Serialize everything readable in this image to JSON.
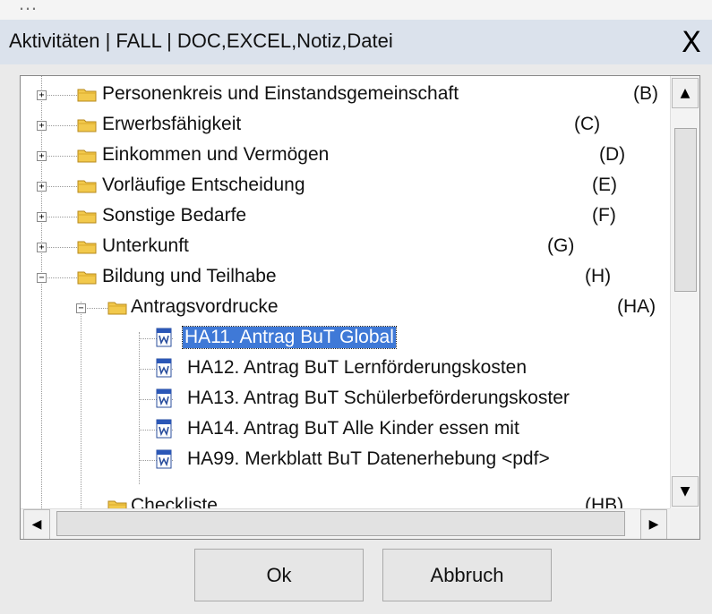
{
  "window": {
    "title": "Aktivitäten | FALL | DOC,EXCEL,Notiz,Datei",
    "close_label": "X",
    "clipped_top_text": "…"
  },
  "tree": {
    "items": [
      {
        "label": "Personenkreis und Einstandsgemeinschaft",
        "code": "(B)",
        "expanded": false
      },
      {
        "label": "Erwerbsfähigkeit",
        "code": "(C)",
        "expanded": false
      },
      {
        "label": "Einkommen und Vermögen",
        "code": "(D)",
        "expanded": false
      },
      {
        "label": "Vorläufige Entscheidung",
        "code": "(E)",
        "expanded": false
      },
      {
        "label": "Sonstige Bedarfe",
        "code": "(F)",
        "expanded": false
      },
      {
        "label": "Unterkunft",
        "code": "(G)",
        "expanded": false
      },
      {
        "label": "Bildung und Teilhabe",
        "code": "(H)",
        "expanded": true
      },
      {
        "label": "Antragsvordrucke",
        "code": "(HA)",
        "expanded": true
      },
      {
        "label": "HA11. Antrag BuT Global",
        "code": "",
        "selected": true
      },
      {
        "label": "HA12. Antrag BuT Lernförderungskosten",
        "code": ""
      },
      {
        "label": "HA13. Antrag BuT Schülerbeförderungskoster",
        "code": ""
      },
      {
        "label": "HA14. Antrag BuT Alle Kinder essen mit",
        "code": ""
      },
      {
        "label": "HA99. Merkblatt BuT Datenerhebung  <pdf>",
        "code": ""
      },
      {
        "label": "Checkliste",
        "code": "(HB)",
        "partially_visible": true
      }
    ]
  },
  "scroll": {
    "up_arrow": "▲",
    "down_arrow": "▼",
    "left_arrow": "◀",
    "right_arrow": "▶"
  },
  "expander_symbols": {
    "collapsed": "+",
    "expanded": "−"
  },
  "buttons": {
    "ok": "Ok",
    "cancel": "Abbruch"
  },
  "colors": {
    "selection": "#3f79d7",
    "titlebar": "#dbe2ec",
    "folder": "#f2c94c"
  },
  "icons": {
    "folder": "folder-icon",
    "document": "word-document-icon"
  }
}
